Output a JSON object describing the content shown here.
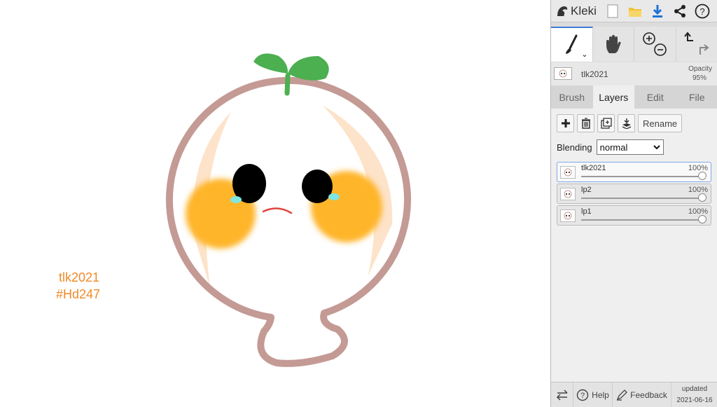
{
  "canvas": {
    "text_line1": "tlk2021",
    "text_line2": "#Hd247",
    "text_color": "#f08a2a"
  },
  "panel": {
    "app_name": "Kleki",
    "layer_info": {
      "name": "tlk2021",
      "opacity_label": "Opacity",
      "opacity_value": "95%"
    },
    "tabs": [
      "Brush",
      "Layers",
      "Edit",
      "File"
    ],
    "active_tab": "Layers",
    "layers_tab": {
      "rename_label": "Rename",
      "blending_label": "Blending",
      "blending_value": "normal",
      "layers": [
        {
          "name": "tlk2021",
          "opacity": "100%",
          "opacity_fraction": 1.0,
          "selected": true
        },
        {
          "name": "lp2",
          "opacity": "100%",
          "opacity_fraction": 1.0,
          "selected": false
        },
        {
          "name": "lp1",
          "opacity": "100%",
          "opacity_fraction": 1.0,
          "selected": false
        }
      ]
    },
    "bottom": {
      "help_label": "Help",
      "feedback_label": "Feedback",
      "updated_label": "updated",
      "updated_date": "2021-06-16"
    }
  },
  "colors": {
    "accent": "#3d7bd6",
    "outline": "#c49a95",
    "leaf": "#4caf50",
    "cheek": "#ffb52a",
    "download_icon": "#1e73d8",
    "folder_icon": "#f3c23a"
  }
}
